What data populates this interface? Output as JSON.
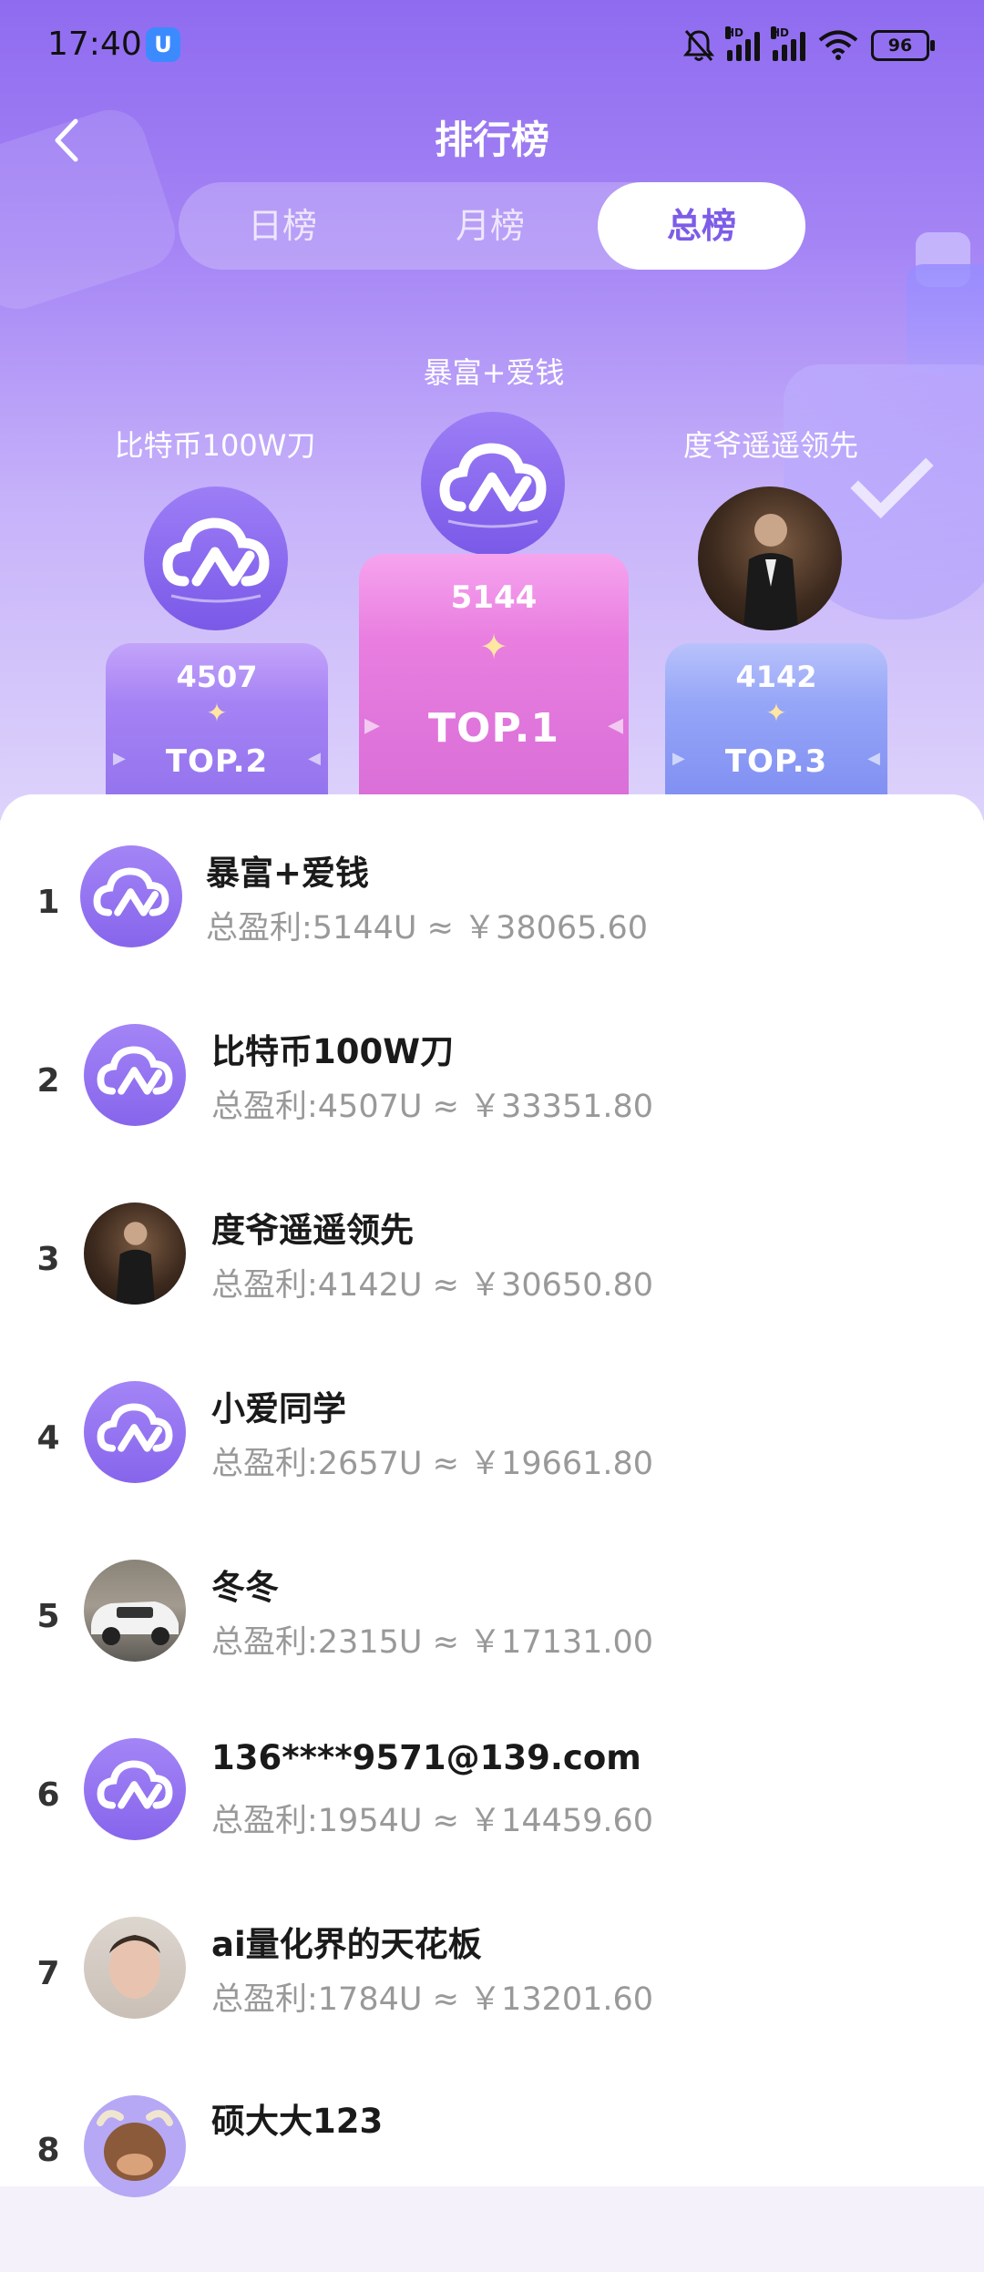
{
  "status_bar": {
    "time": "17:40",
    "app_badge": "U",
    "hd1": "HD",
    "hd2": "HD",
    "battery": "96"
  },
  "header": {
    "title": "排行榜",
    "back_icon": "chevron-left-icon"
  },
  "tabs": [
    {
      "label": "日榜",
      "active": false
    },
    {
      "label": "月榜",
      "active": false
    },
    {
      "label": "总榜",
      "active": true
    }
  ],
  "podium": {
    "first": {
      "name": "暴富+爱钱",
      "score": "5144",
      "label": "TOP.1",
      "avatar": "cloud-logo"
    },
    "second": {
      "name": "比特币100W刀",
      "score": "4507",
      "label": "TOP.2",
      "avatar": "cloud-logo"
    },
    "third": {
      "name": "度爷遥遥领先",
      "score": "4142",
      "label": "TOP.3",
      "avatar": "photo-man-dark-suit"
    }
  },
  "leaderboard": [
    {
      "rank": "1",
      "name": "暴富+爱钱",
      "profit": "总盈利:5144U ≈ ￥38065.60",
      "avatar": "cloud-logo"
    },
    {
      "rank": "2",
      "name": "比特币100W刀",
      "profit": "总盈利:4507U ≈ ￥33351.80",
      "avatar": "cloud-logo"
    },
    {
      "rank": "3",
      "name": "度爷遥遥领先",
      "profit": "总盈利:4142U ≈ ￥30650.80",
      "avatar": "photo-man-dark-suit"
    },
    {
      "rank": "4",
      "name": "小爱同学",
      "profit": "总盈利:2657U ≈ ￥19661.80",
      "avatar": "cloud-logo"
    },
    {
      "rank": "5",
      "name": "冬冬",
      "profit": "总盈利:2315U ≈ ￥17131.00",
      "avatar": "photo-white-suv"
    },
    {
      "rank": "6",
      "name": "136****9571@139.com",
      "profit": "总盈利:1954U ≈ ￥14459.60",
      "avatar": "cloud-logo"
    },
    {
      "rank": "7",
      "name": "ai量化界的天花板",
      "profit": "总盈利:1784U ≈ ￥13201.60",
      "avatar": "photo-man-face"
    },
    {
      "rank": "8",
      "name": "硕大大123",
      "profit": "",
      "avatar": "photo-cartoon-bull"
    }
  ]
}
